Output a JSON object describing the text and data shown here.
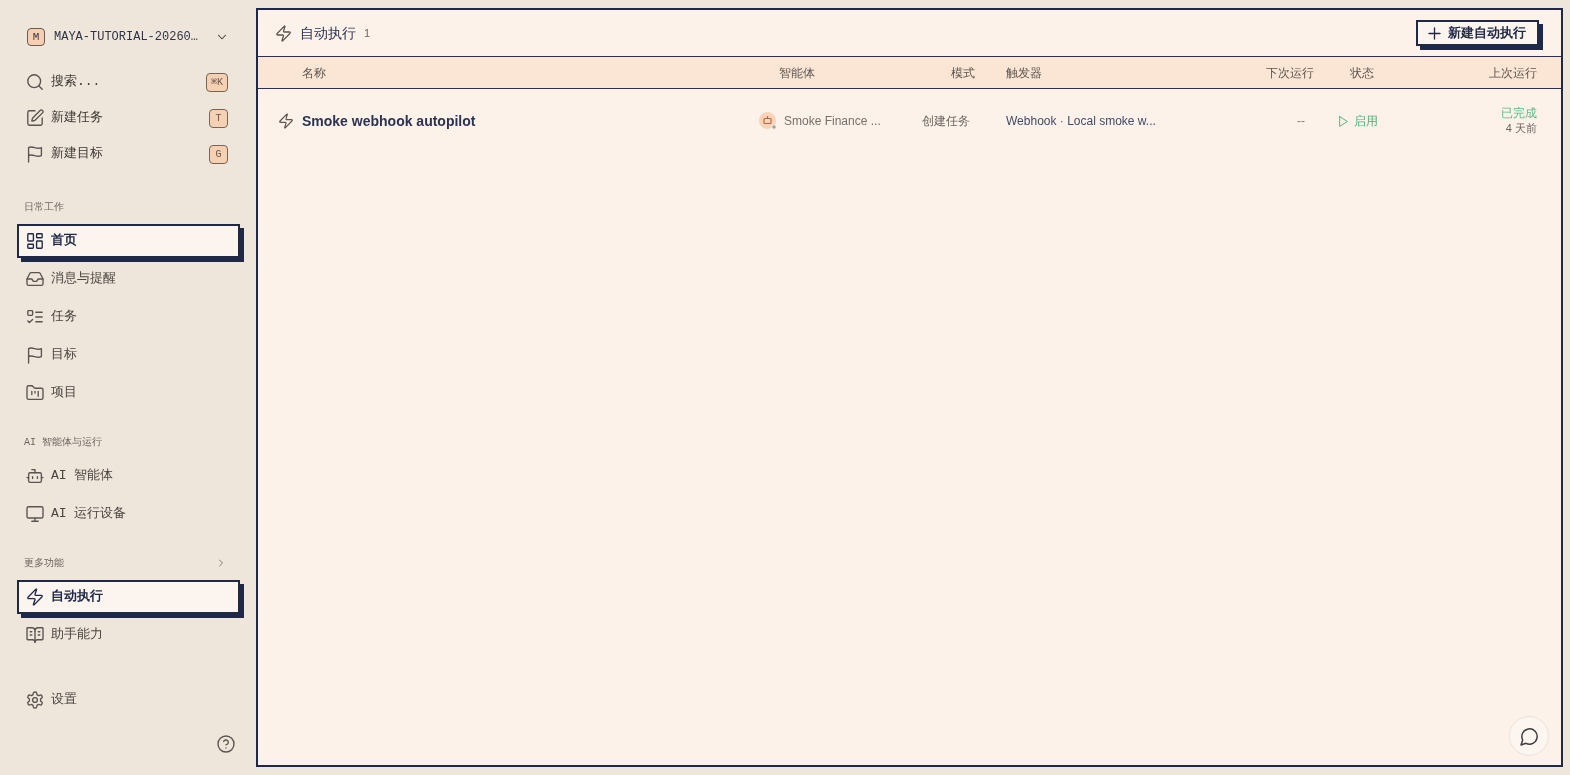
{
  "workspace": {
    "avatar": "M",
    "name": "MAYA-TUTORIAL-20260…"
  },
  "sidebar": {
    "actions": [
      {
        "label": "搜索...",
        "shortcut": "⌘K"
      },
      {
        "label": "新建任务",
        "shortcut": "T"
      },
      {
        "label": "新建目标",
        "shortcut": "G"
      }
    ],
    "sections": [
      {
        "title": "日常工作",
        "expandable": false,
        "items": [
          {
            "label": "首页",
            "selected": true
          },
          {
            "label": "消息与提醒",
            "selected": false
          },
          {
            "label": "任务",
            "selected": false
          },
          {
            "label": "目标",
            "selected": false
          },
          {
            "label": "项目",
            "selected": false
          }
        ]
      },
      {
        "title": "AI 智能体与运行",
        "expandable": false,
        "items": [
          {
            "label": "AI 智能体",
            "selected": false
          },
          {
            "label": "AI 运行设备",
            "selected": false
          }
        ]
      },
      {
        "title": "更多功能",
        "expandable": true,
        "items": [
          {
            "label": "自动执行",
            "selected": true
          },
          {
            "label": "助手能力",
            "selected": false
          }
        ]
      }
    ],
    "footer_items": [
      {
        "label": "设置",
        "selected": false
      }
    ]
  },
  "page": {
    "title": "自动执行",
    "count": "1",
    "new_button": "新建自动执行"
  },
  "table": {
    "columns": [
      "名称",
      "智能体",
      "模式",
      "触发器",
      "下次运行",
      "状态",
      "上次运行"
    ],
    "rows": [
      {
        "name": "Smoke webhook autopilot",
        "agent": "Smoke Finance ...",
        "mode": "创建任务",
        "trigger": "Webhook · Local smoke w...",
        "next_run": "--",
        "status": "启用",
        "last_run": {
          "status": "已完成",
          "time": "4 天前"
        }
      }
    ]
  }
}
